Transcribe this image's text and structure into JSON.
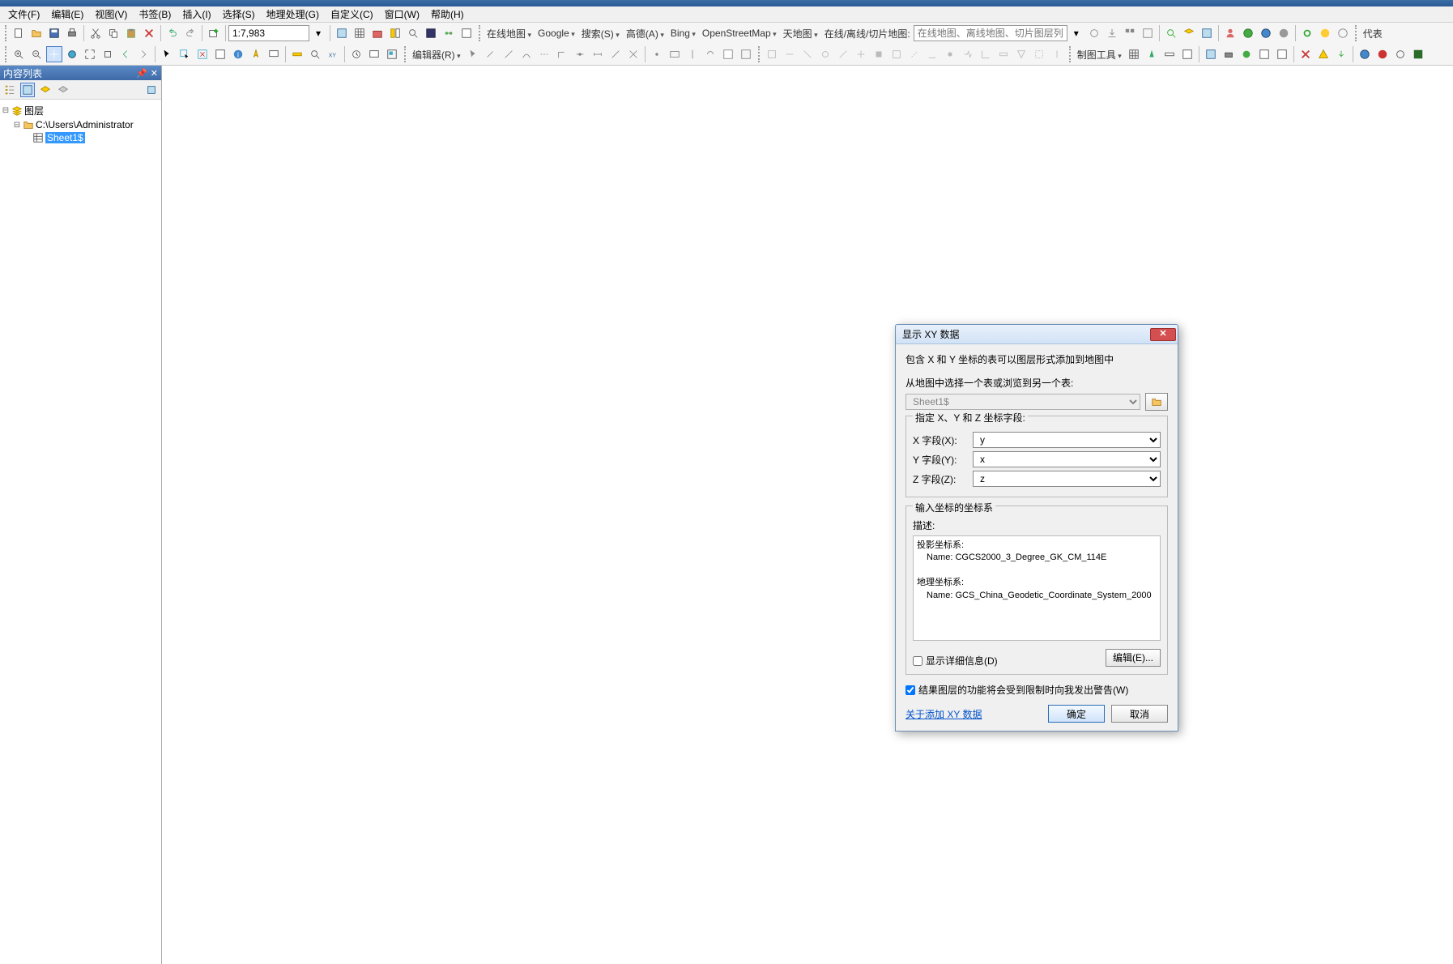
{
  "menu": {
    "file": "文件(F)",
    "edit": "编辑(E)",
    "view": "视图(V)",
    "bookmark": "书签(B)",
    "insert": "插入(I)",
    "select": "选择(S)",
    "geoprocess": "地理处理(G)",
    "customize": "自定义(C)",
    "window": "窗口(W)",
    "help": "帮助(H)"
  },
  "toolbar": {
    "scale": "1:7,983",
    "editor": "编辑器(R)",
    "online_map": "在线地图",
    "google": "Google",
    "search": "搜索(S)",
    "gaode": "高德(A)",
    "bing": "Bing",
    "osm": "OpenStreetMap",
    "tianditu": "天地图",
    "toggle_map": "在线/离线/切片地图:",
    "placeholder": "在线地图、离线地图、切片图层列表",
    "mapping_tools": "制图工具",
    "repr": "代表"
  },
  "toc": {
    "title": "内容列表",
    "root": "图层",
    "folder": "C:\\Users\\Administrator",
    "sheet": "Sheet1$"
  },
  "dialog": {
    "title": "显示 XY 数据",
    "desc": "包含 X 和 Y 坐标的表可以图层形式添加到地图中",
    "select_label": "从地图中选择一个表或浏览到另一个表:",
    "table_value": "Sheet1$",
    "fields_legend": "指定 X、Y 和 Z 坐标字段:",
    "x_label": "X 字段(X):",
    "y_label": "Y 字段(Y):",
    "z_label": "Z 字段(Z):",
    "x_val": "y",
    "y_val": "x",
    "z_val": "z",
    "coord_title": "输入坐标的坐标系",
    "coord_desc_label": "描述:",
    "proj_label": "投影坐标系:",
    "proj_name": "Name: CGCS2000_3_Degree_GK_CM_114E",
    "geo_label": "地理坐标系:",
    "geo_name": "Name: GCS_China_Geodetic_Coordinate_System_2000",
    "show_detail": "显示详细信息(D)",
    "edit_btn": "编辑(E)...",
    "warn_check": "结果图层的功能将会受到限制时向我发出警告(W)",
    "about_link": "关于添加 XY 数据",
    "ok": "确定",
    "cancel": "取消"
  }
}
